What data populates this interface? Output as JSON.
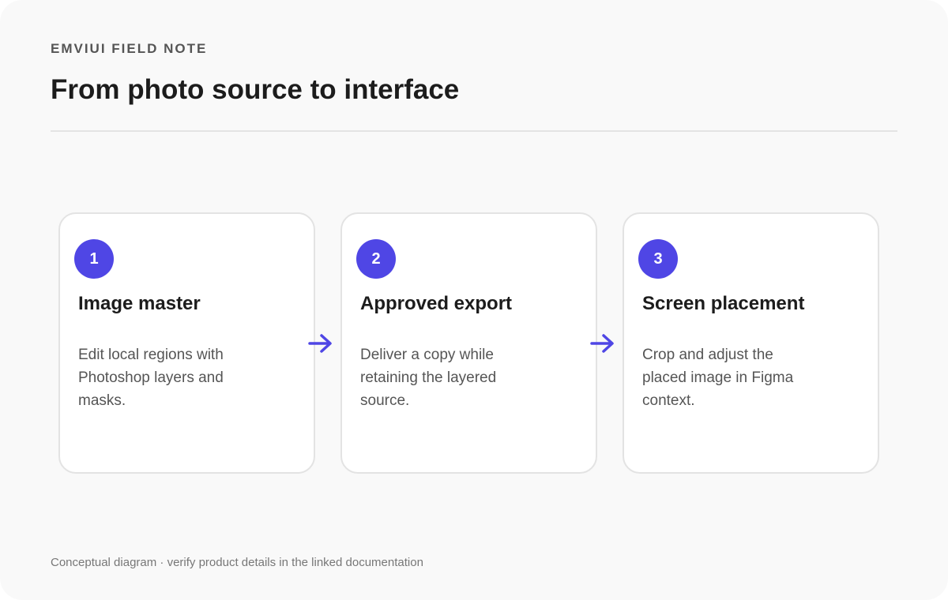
{
  "header": {
    "eyebrow": "EMVIUI FIELD NOTE",
    "title": "From photo source to interface"
  },
  "steps": [
    {
      "number": "1",
      "title": "Image master",
      "description": "Edit local regions with Photoshop layers and masks."
    },
    {
      "number": "2",
      "title": "Approved export",
      "description": "Deliver a copy while retaining the layered source."
    },
    {
      "number": "3",
      "title": "Screen placement",
      "description": "Crop and adjust the placed image in Figma context."
    }
  ],
  "connectors": [
    "arrow-right-icon",
    "arrow-right-icon"
  ],
  "footer": {
    "note": "Conceptual diagram · verify product details in the linked documentation"
  },
  "colors": {
    "accent": "#4f46e5",
    "background": "#f9f9f9",
    "card": "#ffffff",
    "card_border": "#e3e3e3",
    "heading": "#1c1c1c",
    "body_text": "#555555"
  }
}
